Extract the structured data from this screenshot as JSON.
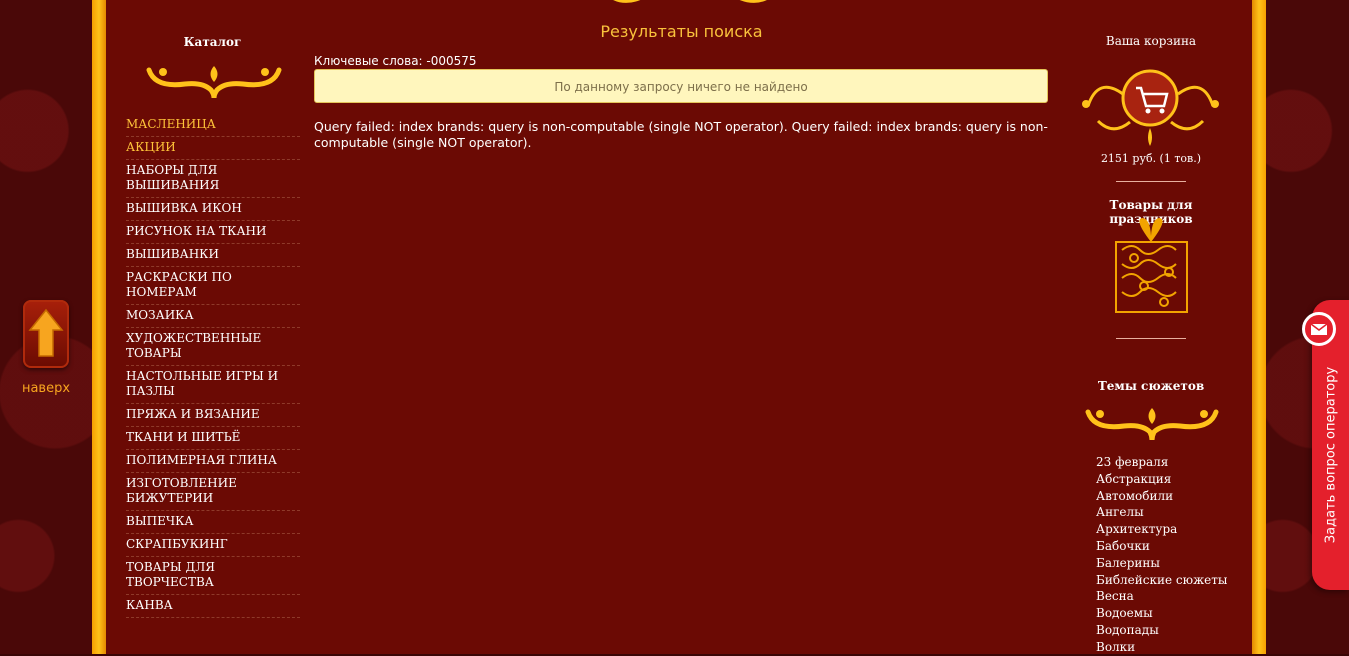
{
  "catalog": {
    "title": "Каталог",
    "items": [
      "МАСЛЕНИЦА",
      "АКЦИИ",
      "НАБОРЫ ДЛЯ ВЫШИВАНИЯ",
      "ВЫШИВКА ИКОН",
      "РИСУНОК НА ТКАНИ",
      "ВЫШИВАНКИ",
      "РАСКРАСКИ ПО НОМЕРАМ",
      "МОЗАИКА",
      "ХУДОЖЕСТВЕННЫЕ ТОВАРЫ",
      "НАСТОЛЬНЫЕ ИГРЫ И ПАЗЛЫ",
      "ПРЯЖА И ВЯЗАНИЕ",
      "ТКАНИ И ШИТЬЁ",
      "ПОЛИМЕРНАЯ ГЛИНА",
      "ИЗГОТОВЛЕНИЕ БИЖУТЕРИИ",
      "ВЫПЕЧКА",
      "СКРАПБУКИНГ",
      "ТОВАРЫ ДЛЯ ТВОРЧЕСТВА",
      "КАНВА"
    ],
    "highlighted": [
      "МАСЛЕНИЦА",
      "АКЦИИ"
    ]
  },
  "up_button": {
    "label": "наверх",
    "icon": "arrow-up-icon"
  },
  "search": {
    "title": "Результаты поиска",
    "keywords": "Ключевые слова: -000575",
    "notice": "По данному запросу ничего не найдено",
    "error": "Query failed: index brands: query is non-computable (single NOT operator). Query failed: index brands: query is non-computable (single NOT operator)."
  },
  "cart": {
    "title": "Ваша корзина",
    "summary": "2151 руб.   (1 тов.)",
    "icon": "cart-icon"
  },
  "gifts": {
    "title": "Товары для праздников",
    "icon": "gift-box-icon"
  },
  "themes": {
    "title": "Темы сюжетов",
    "items": [
      "23 февраля",
      "Абстракция",
      "Автомобили",
      "Ангелы",
      "Архитектура",
      "Бабочки",
      "Балерины",
      "Библейские сюжеты",
      "Весна",
      "Водоемы",
      "Водопады",
      "Волки"
    ]
  },
  "operator": {
    "label": "Задать вопрос оператору",
    "icon": "mail-icon"
  },
  "colors": {
    "main_bg": "#6b0a04",
    "gold": "#ffc21a",
    "accent_text": "#f9c23c",
    "notice_bg": "#fff6bd",
    "operator_red": "#e4202c"
  }
}
